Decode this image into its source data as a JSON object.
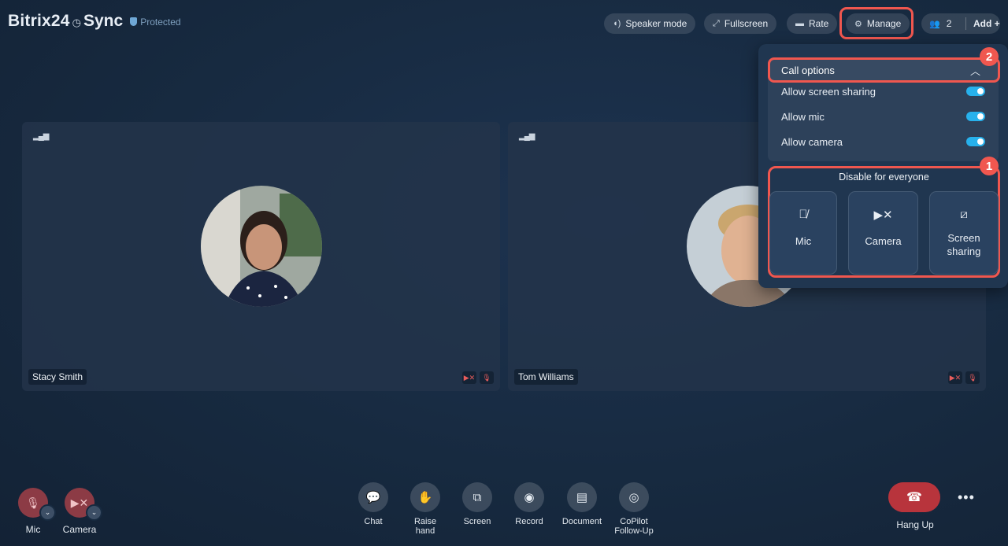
{
  "header": {
    "brand_part1": "Bitrix24",
    "brand_part2": "Sync",
    "protected_label": "Protected",
    "buttons": {
      "speaker_mode": "Speaker mode",
      "fullscreen": "Fullscreen",
      "rate": "Rate",
      "manage": "Manage",
      "participants_count": "2",
      "add": "Add +"
    }
  },
  "participants": [
    {
      "name": "Stacy Smith"
    },
    {
      "name": "Tom Williams"
    }
  ],
  "manage_panel": {
    "call_options_title": "Call options",
    "options": [
      {
        "label": "Allow screen sharing",
        "enabled": true
      },
      {
        "label": "Allow mic",
        "enabled": true
      },
      {
        "label": "Allow camera",
        "enabled": true
      }
    ],
    "disable_title": "Disable for everyone",
    "disable_buttons": [
      "Mic",
      "Camera",
      "Screen sharing"
    ],
    "step_badges": [
      "1",
      "2"
    ]
  },
  "controls": {
    "mic": "Mic",
    "camera": "Camera",
    "chat": "Chat",
    "raise_hand": "Raise hand",
    "screen": "Screen",
    "record": "Record",
    "document": "Document",
    "copilot": "CoPilot Follow-Up",
    "hang_up": "Hang Up"
  },
  "colors": {
    "accent_highlight": "#f0574f",
    "toggle_on": "#27b1ec",
    "hang_up": "#b8343c",
    "muted_control": "#8c3b45"
  }
}
